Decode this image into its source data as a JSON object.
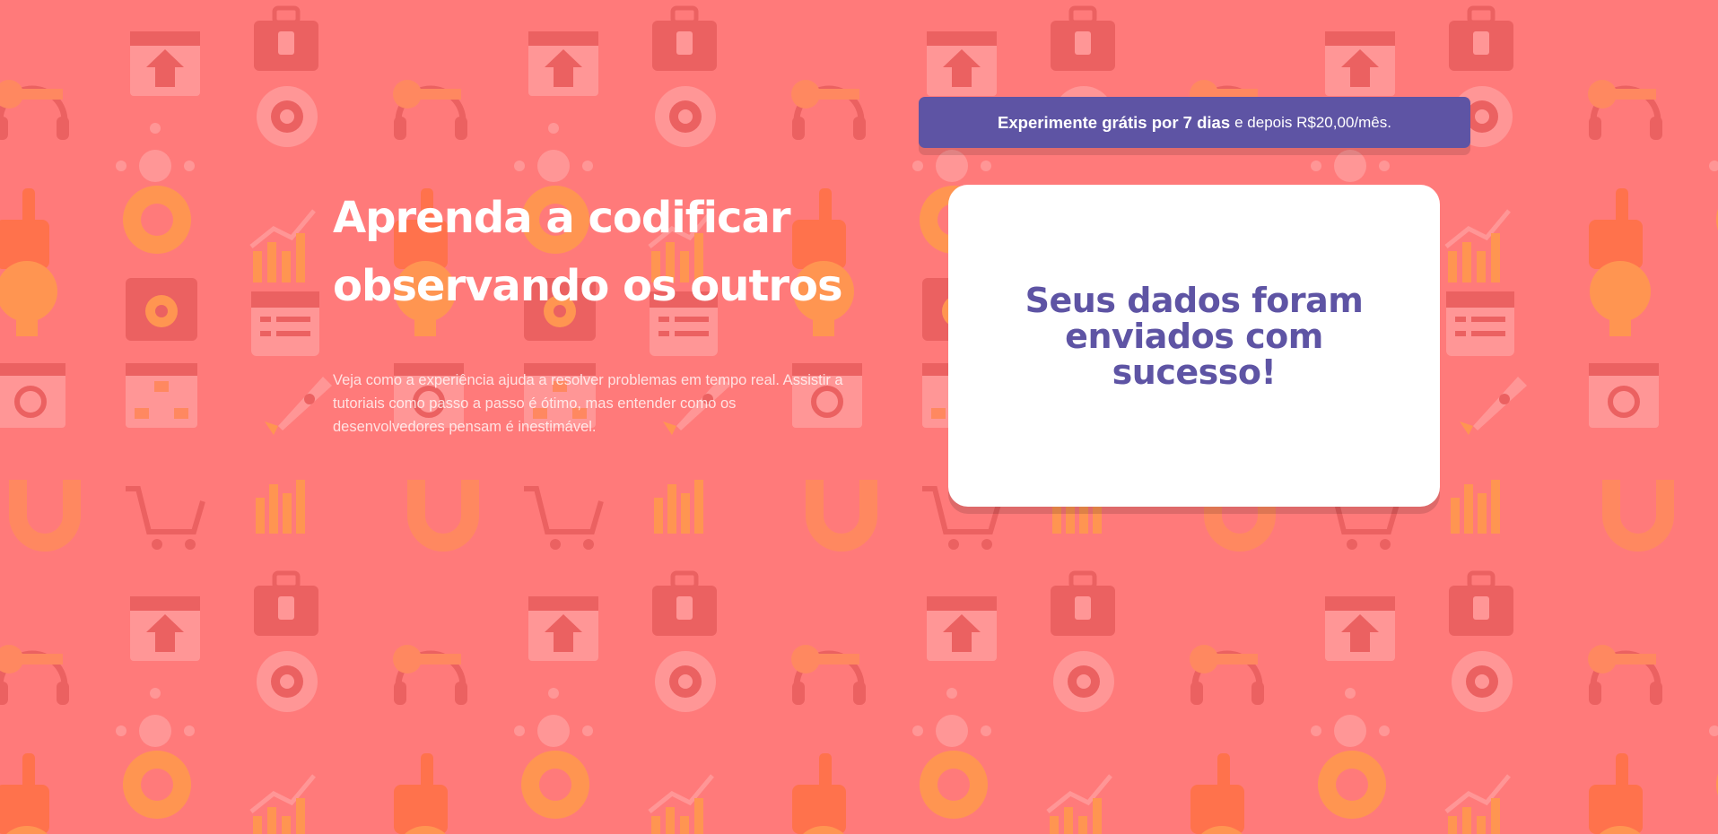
{
  "colors": {
    "background": "#ff7a7a",
    "accent": "#5e54a4",
    "card": "#ffffff"
  },
  "hero": {
    "title_line1": "Aprenda a codificar",
    "title_line2": "observando os outros",
    "description": "Veja como a experiência ajuda a resolver problemas em tempo real. Assistir a tutoriais como passo a passo é ótimo, mas entender como os desenvolvedores pensam é inestimável."
  },
  "trial_banner": {
    "strong_text": "Experimente grátis por 7 dias",
    "rest_text": "e depois R$20,00/mês."
  },
  "success_card": {
    "message": "Seus dados foram enviados com sucesso!"
  },
  "background_icons": [
    "magnet-icon",
    "browser-window-icon",
    "bar-chart-icon",
    "toolbox-icon",
    "headset-icon",
    "network-hub-icon",
    "thumbs-up-icon",
    "growth-chart-icon",
    "folder-gear-icon",
    "rocket-icon",
    "search-window-icon",
    "shopping-cart-icon",
    "key-icon",
    "globe-gear-icon",
    "lifebuoy-icon",
    "calendar-list-icon",
    "lightbulb-icon",
    "sitemap-icon"
  ]
}
